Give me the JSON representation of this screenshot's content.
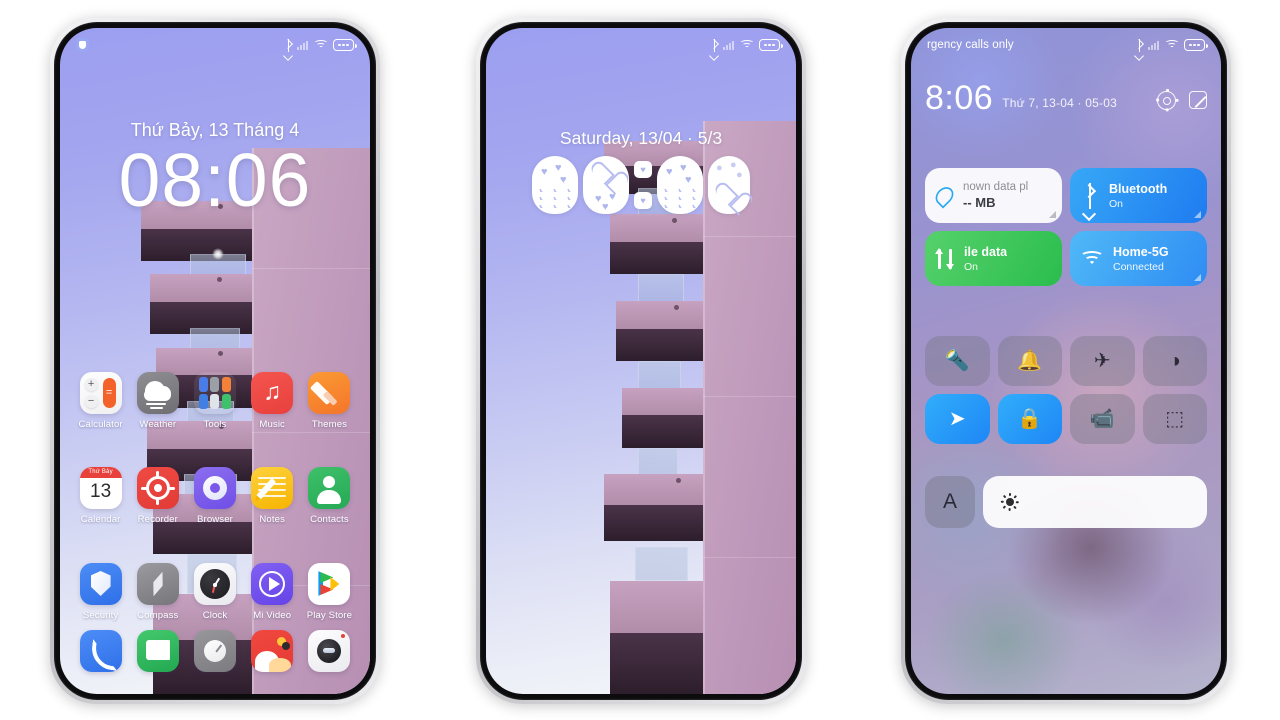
{
  "phone1": {
    "name": "lock-home-screen",
    "statusbar": {
      "security_icon": "shield-icon",
      "icons": [
        "bluetooth-icon",
        "signal-icon",
        "wifi-icon",
        "battery-icon"
      ]
    },
    "lockscreen": {
      "date": "Thứ Bảy, 13 Tháng 4",
      "time": "08:06"
    },
    "apps_row1": [
      {
        "label": "Calculator",
        "icon": "calculator-icon"
      },
      {
        "label": "Weather",
        "icon": "weather-icon"
      },
      {
        "label": "Tools",
        "icon": "tools-folder-icon"
      },
      {
        "label": "Music",
        "icon": "music-icon"
      },
      {
        "label": "Themes",
        "icon": "themes-icon"
      }
    ],
    "apps_row2": [
      {
        "label": "Calendar",
        "icon": "calendar-icon",
        "cal_weekday": "Thứ Bảy",
        "cal_day": "13"
      },
      {
        "label": "Recorder",
        "icon": "recorder-icon"
      },
      {
        "label": "Browser",
        "icon": "browser-icon"
      },
      {
        "label": "Notes",
        "icon": "notes-icon"
      },
      {
        "label": "Contacts",
        "icon": "contacts-icon"
      }
    ],
    "apps_row3": [
      {
        "label": "Security",
        "icon": "security-icon"
      },
      {
        "label": "Compass",
        "icon": "compass-icon"
      },
      {
        "label": "Clock",
        "icon": "clock-icon"
      },
      {
        "label": "Mi Video",
        "icon": "mi-video-icon"
      },
      {
        "label": "Play Store",
        "icon": "play-store-icon"
      }
    ],
    "dock": [
      {
        "label": "Phone",
        "icon": "phone-icon"
      },
      {
        "label": "Messages",
        "icon": "messages-icon"
      },
      {
        "label": "Settings",
        "icon": "settings-icon"
      },
      {
        "label": "Gallery",
        "icon": "gallery-icon"
      },
      {
        "label": "Camera",
        "icon": "camera-icon"
      }
    ]
  },
  "phone2": {
    "name": "lock-screen-decorative-clock",
    "statusbar": {
      "icons": [
        "bluetooth-icon",
        "signal-icon",
        "wifi-icon",
        "battery-icon"
      ]
    },
    "date": "Saturday, 13/04 · 5/3",
    "time": "08:06",
    "clock_digits": [
      "0",
      "8",
      ":",
      "0",
      "6"
    ]
  },
  "phone3": {
    "name": "control-center",
    "statusbar": {
      "carrier": "rgency calls only",
      "icons": [
        "bluetooth-icon",
        "signal-icon",
        "wifi-icon",
        "battery-icon"
      ]
    },
    "header": {
      "time": "8:06",
      "date": "Thứ 7, 13-04 · 05-03",
      "settings_icon": "gear-icon",
      "edit_icon": "edit-icon"
    },
    "big_tiles": [
      {
        "title": "nown data pl",
        "subtitle": "-- MB",
        "icon": "data-drop-icon",
        "state": "off",
        "style": "white"
      },
      {
        "title": "Bluetooth",
        "subtitle": "On",
        "icon": "bluetooth-icon",
        "state": "on",
        "style": "blue"
      },
      {
        "title": "ile data",
        "subtitle": "On",
        "icon": "mobile-data-icon",
        "state": "on",
        "style": "green"
      },
      {
        "title": "Home-5G",
        "subtitle": "Connected",
        "icon": "wifi-icon",
        "state": "on",
        "style": "cyan"
      }
    ],
    "small_tiles": [
      {
        "name": "flashlight",
        "glyph": "🔦",
        "state": "off"
      },
      {
        "name": "ringer",
        "glyph": "🔔",
        "state": "off"
      },
      {
        "name": "airplane-mode",
        "glyph": "✈",
        "state": "off"
      },
      {
        "name": "dark-mode",
        "glyph": "◑",
        "state": "off"
      },
      {
        "name": "location",
        "glyph": "➤",
        "state": "on"
      },
      {
        "name": "auto-rotate",
        "glyph": "🔒",
        "state": "on"
      },
      {
        "name": "screen-recorder",
        "glyph": "📹",
        "state": "off"
      },
      {
        "name": "screenshot",
        "glyph": "⬚",
        "state": "off"
      }
    ],
    "brightness": {
      "auto_label": "A",
      "slider_icon": "sun-icon",
      "level": 100
    }
  },
  "colors": {
    "accent_blue": "#2f7bf0",
    "accent_green": "#2bbd4e",
    "accent_cyan": "#2f8cf3",
    "wallpaper_sky": "#a3a5ef",
    "wallpaper_building": "#bc96b8"
  }
}
